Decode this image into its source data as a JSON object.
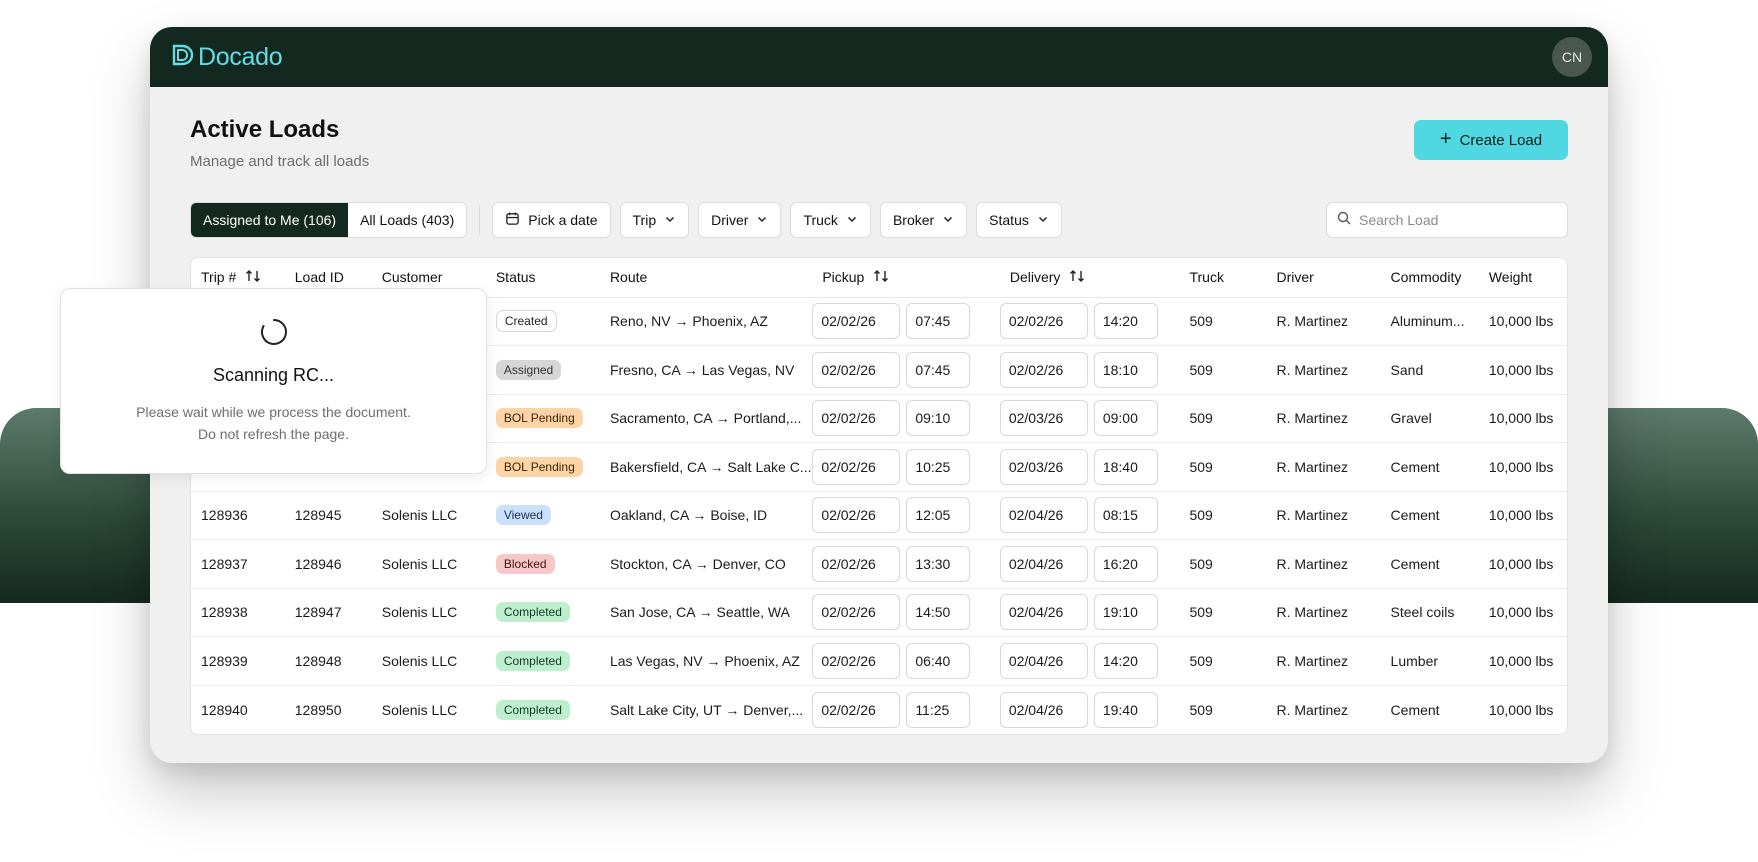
{
  "app": {
    "name": "Docado",
    "avatar_initials": "CN",
    "brand_color": "#62dce6"
  },
  "page": {
    "title": "Active Loads",
    "subtitle": "Manage and track all loads",
    "create_label": "Create Load"
  },
  "tabs": [
    {
      "label": "Assigned to Me (106)",
      "active": true
    },
    {
      "label": "All Loads (403)",
      "active": false
    }
  ],
  "filters": {
    "date_label": "Pick a date",
    "trip": "Trip",
    "driver": "Driver",
    "truck": "Truck",
    "broker": "Broker",
    "status": "Status"
  },
  "search": {
    "placeholder": "Search Load",
    "value": ""
  },
  "table": {
    "columns": [
      "Trip #",
      "Load ID",
      "Customer",
      "Status",
      "Route",
      "Pickup",
      "Delivery",
      "Truck",
      "Driver",
      "Commodity",
      "Weight"
    ],
    "rows": [
      {
        "trip": "",
        "load": "",
        "customer": "",
        "status": "Created",
        "status_type": "created",
        "route": "Reno, NV → Phoenix, AZ",
        "pickup_date": "02/02/26",
        "pickup_time": "07:45",
        "delivery_date": "02/02/26",
        "delivery_time": "14:20",
        "truck": "509",
        "driver": "R. Martinez",
        "commodity": "Aluminum...",
        "weight": "10,000 lbs"
      },
      {
        "trip": "",
        "load": "",
        "customer": "",
        "status": "Assigned",
        "status_type": "assigned",
        "route": "Fresno, CA → Las Vegas, NV",
        "pickup_date": "02/02/26",
        "pickup_time": "07:45",
        "delivery_date": "02/02/26",
        "delivery_time": "18:10",
        "truck": "509",
        "driver": "R. Martinez",
        "commodity": "Sand",
        "weight": "10,000 lbs"
      },
      {
        "trip": "",
        "load": "",
        "customer": "",
        "status": "BOL Pending",
        "status_type": "pending",
        "route": "Sacramento, CA → Portland,...",
        "pickup_date": "02/02/26",
        "pickup_time": "09:10",
        "delivery_date": "02/03/26",
        "delivery_time": "09:00",
        "truck": "509",
        "driver": "R. Martinez",
        "commodity": "Gravel",
        "weight": "10,000 lbs"
      },
      {
        "trip": "",
        "load": "",
        "customer": "",
        "status": "BOL Pending",
        "status_type": "pending",
        "route": "Bakersfield, CA → Salt Lake C...",
        "pickup_date": "02/02/26",
        "pickup_time": "10:25",
        "delivery_date": "02/03/26",
        "delivery_time": "18:40",
        "truck": "509",
        "driver": "R. Martinez",
        "commodity": "Cement",
        "weight": "10,000 lbs"
      },
      {
        "trip": "128936",
        "load": "128945",
        "customer": "Solenis LLC",
        "status": "Viewed",
        "status_type": "viewed",
        "route": "Oakland, CA → Boise, ID",
        "pickup_date": "02/02/26",
        "pickup_time": "12:05",
        "delivery_date": "02/04/26",
        "delivery_time": "08:15",
        "truck": "509",
        "driver": "R. Martinez",
        "commodity": "Cement",
        "weight": "10,000 lbs"
      },
      {
        "trip": "128937",
        "load": "128946",
        "customer": "Solenis LLC",
        "status": "Blocked",
        "status_type": "blocked",
        "route": "Stockton, CA → Denver, CO",
        "pickup_date": "02/02/26",
        "pickup_time": "13:30",
        "delivery_date": "02/04/26",
        "delivery_time": "16:20",
        "truck": "509",
        "driver": "R. Martinez",
        "commodity": "Cement",
        "weight": "10,000 lbs"
      },
      {
        "trip": "128938",
        "load": "128947",
        "customer": "Solenis LLC",
        "status": "Completed",
        "status_type": "completed",
        "route": "San Jose, CA → Seattle, WA",
        "pickup_date": "02/02/26",
        "pickup_time": "14:50",
        "delivery_date": "02/04/26",
        "delivery_time": "19:10",
        "truck": "509",
        "driver": "R. Martinez",
        "commodity": "Steel coils",
        "weight": "10,000 lbs"
      },
      {
        "trip": "128939",
        "load": "128948",
        "customer": "Solenis LLC",
        "status": "Completed",
        "status_type": "completed",
        "route": "Las Vegas, NV → Phoenix, AZ",
        "pickup_date": "02/02/26",
        "pickup_time": "06:40",
        "delivery_date": "02/04/26",
        "delivery_time": "14:20",
        "truck": "509",
        "driver": "R. Martinez",
        "commodity": "Lumber",
        "weight": "10,000 lbs"
      },
      {
        "trip": "128940",
        "load": "128950",
        "customer": "Solenis LLC",
        "status": "Completed",
        "status_type": "completed",
        "route": "Salt Lake City, UT → Denver,...",
        "pickup_date": "02/02/26",
        "pickup_time": "11:25",
        "delivery_date": "02/04/26",
        "delivery_time": "19:40",
        "truck": "509",
        "driver": "R. Martinez",
        "commodity": "Cement",
        "weight": "10,000 lbs"
      }
    ]
  },
  "overlay": {
    "title": "Scanning RC...",
    "line1": "Please wait while we process the document.",
    "line2": "Do not refresh the page."
  },
  "colors": {
    "header_bg": "#13291f",
    "accent": "#4fd8e2"
  },
  "icons": {
    "logo": "docado-logo-icon",
    "plus": "plus-icon",
    "calendar": "calendar-icon",
    "chevron": "chevron-down-icon",
    "search": "search-icon",
    "sort": "sort-icon",
    "spinner": "spinner-icon"
  }
}
